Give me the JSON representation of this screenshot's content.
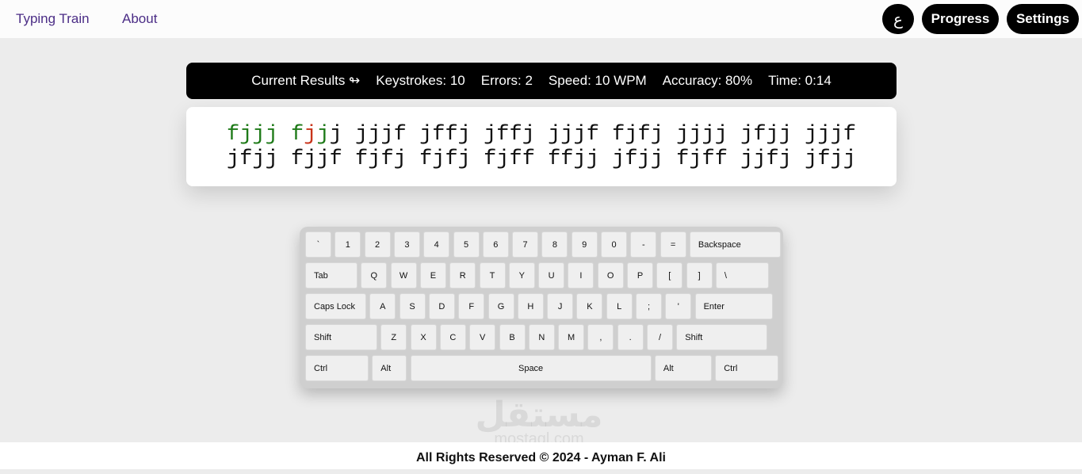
{
  "nav": {
    "home_label": "Typing Train",
    "about_label": "About",
    "lang_label": "ع",
    "progress_label": "Progress",
    "settings_label": "Settings"
  },
  "results": {
    "title": "Current Results ↬",
    "keystrokes": "Keystrokes: 10",
    "errors": "Errors: 2",
    "speed": "Speed: 10 WPM",
    "accuracy": "Accuracy: 80%",
    "time": "Time: 0:14"
  },
  "practice": {
    "line1": "fjjj fjjj jjjf jffj jffj jjjf fjfj jjjj jfjj jjjf",
    "line2": "jfjj fjjf fjfj fjfj fjff ffjj jfjj fjff jjfj jfjj",
    "status_colors": {
      "correct": "#1e7a18",
      "error": "#c8331a",
      "pending": "#111111"
    },
    "typed_status": [
      "correct",
      "correct",
      "correct",
      "correct",
      "correct",
      "correct",
      "error",
      "correct",
      "pending"
    ]
  },
  "keyboard": {
    "rows": [
      [
        "`",
        "1",
        "2",
        "3",
        "4",
        "5",
        "6",
        "7",
        "8",
        "9",
        "0",
        "-",
        "=",
        "Backspace"
      ],
      [
        "Tab",
        "Q",
        "W",
        "E",
        "R",
        "T",
        "Y",
        "U",
        "I",
        "O",
        "P",
        "[",
        "]",
        "\\"
      ],
      [
        "Caps Lock",
        "A",
        "S",
        "D",
        "F",
        "G",
        "H",
        "J",
        "K",
        "L",
        ";",
        "'",
        "Enter"
      ],
      [
        "Shift",
        "Z",
        "X",
        "C",
        "V",
        "B",
        "N",
        "M",
        ",",
        ".",
        "/",
        "Shift"
      ],
      [
        "Ctrl",
        "Alt",
        "Space",
        "Alt",
        "Ctrl"
      ]
    ]
  },
  "watermark": {
    "arabic": "مستقل",
    "latin": "mostaql.com"
  },
  "footer": {
    "text": "All Rights Reserved © 2024 - Ayman F. Ali"
  }
}
